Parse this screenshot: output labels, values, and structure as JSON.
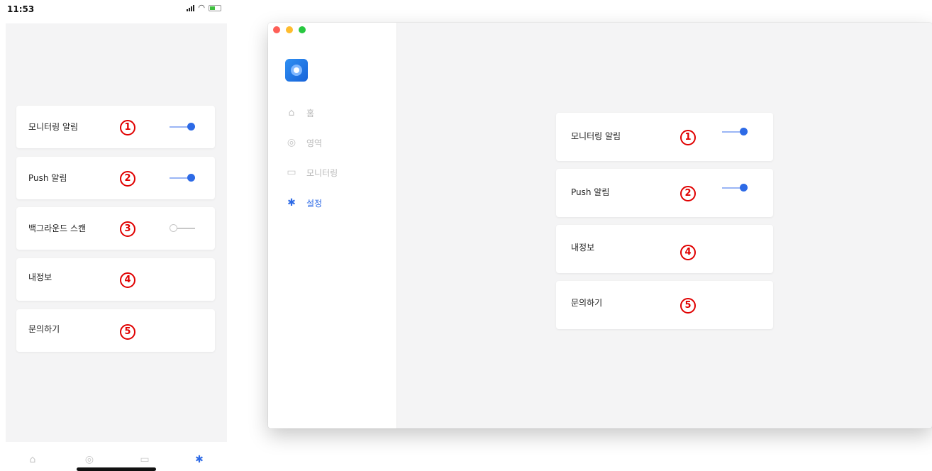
{
  "mobile": {
    "status_time": "11:53",
    "settings": [
      {
        "label": "모니터링 알림",
        "marker": "1",
        "toggle": "on"
      },
      {
        "label": "Push 알림",
        "marker": "2",
        "toggle": "on"
      },
      {
        "label": "백그라운드 스캔",
        "marker": "3",
        "toggle": "off"
      },
      {
        "label": "내정보",
        "marker": "4"
      },
      {
        "label": "문의하기",
        "marker": "5"
      }
    ],
    "tabbar": [
      "home-icon",
      "radar-icon",
      "cast-icon",
      "gear-icon"
    ],
    "active_tab": "gear-icon"
  },
  "desktop": {
    "sidebar": {
      "items": [
        {
          "label": "홈",
          "icon": "home-icon"
        },
        {
          "label": "영역",
          "icon": "radar-icon"
        },
        {
          "label": "모니터링",
          "icon": "cast-icon"
        },
        {
          "label": "설정",
          "icon": "gear-icon",
          "active": true
        }
      ]
    },
    "settings": [
      {
        "label": "모니터링 알림",
        "marker": "1",
        "toggle": "on"
      },
      {
        "label": "Push 알림",
        "marker": "2",
        "toggle": "on"
      },
      {
        "label": "내정보",
        "marker": "4"
      },
      {
        "label": "문의하기",
        "marker": "5"
      }
    ]
  },
  "colors": {
    "accent": "#2d6ae6",
    "marker": "#e00000",
    "background": "#f4f4f5"
  }
}
